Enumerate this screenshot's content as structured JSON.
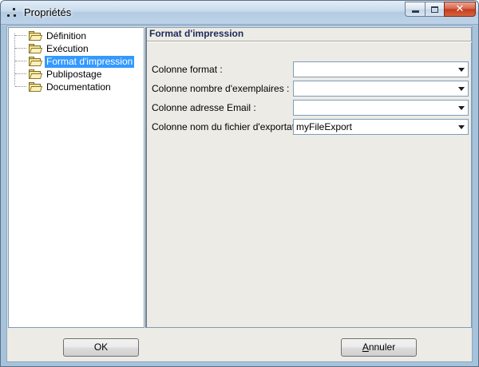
{
  "window": {
    "title": "Propriétés",
    "controls": {
      "minimize_icon": "minimize-icon",
      "maximize_icon": "maximize-icon",
      "close_icon": "close-icon"
    }
  },
  "tree": {
    "items": [
      {
        "label": "Définition",
        "icon": "folder-icon",
        "selected": false
      },
      {
        "label": "Exécution",
        "icon": "folder-icon",
        "selected": false
      },
      {
        "label": "Format d'impression",
        "icon": "folder-icon",
        "selected": true
      },
      {
        "label": "Publipostage",
        "icon": "folder-icon",
        "selected": false
      },
      {
        "label": "Documentation",
        "icon": "folder-icon",
        "selected": false
      }
    ]
  },
  "panel": {
    "header": "Format d'impression",
    "fields": [
      {
        "label": "Colonne format :",
        "value": ""
      },
      {
        "label": "Colonne nombre d'exemplaires :",
        "value": ""
      },
      {
        "label": "Colonne adresse Email :",
        "value": ""
      },
      {
        "label": "Colonne nom du fichier d'exportation",
        "value": "myFileExport"
      }
    ]
  },
  "buttons": {
    "ok_label": "OK",
    "cancel_label_mnemonic": "A",
    "cancel_label_rest": "nnuler"
  },
  "colors": {
    "selection": "#3399ff",
    "header_text": "#1c2a5c",
    "close_button": "#c43c1c"
  }
}
